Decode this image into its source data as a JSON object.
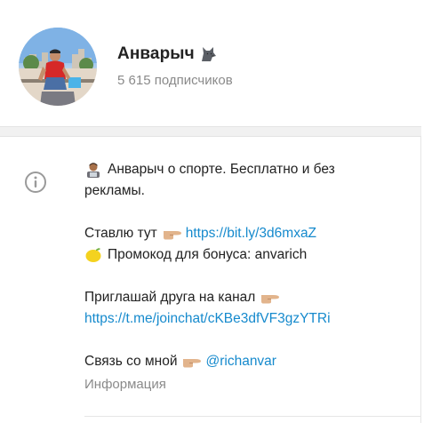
{
  "channel": {
    "name": "Анварыч",
    "name_emoji": "wolf-emoji",
    "subscribers": "5 615 подписчиков",
    "avatar": "channel-avatar-photo"
  },
  "info": {
    "icon": "info-icon",
    "caption": "Информация",
    "description": {
      "line1_emoji": "man-technologist-emoji",
      "line1": "Анварыч о спорте. Бесплатно и без",
      "line2": "рекламы.",
      "bet_text": "Ставлю тут",
      "bet_emoji": "pointing-right-emoji",
      "bet_link": "https://bit.ly/3d6mxaZ",
      "promo_emoji": "lemon-emoji",
      "promo_text": "Промокод для бонуса: anvarich",
      "invite_text": "Приглашай друга на канал",
      "invite_emoji": "pointing-right-emoji",
      "invite_link": "https://t.me/joinchat/cKBe3dfVF3gzYTRi",
      "contact_text": "Связь со мной",
      "contact_emoji": "pointing-right-emoji",
      "contact_link": "@richanvar"
    }
  },
  "colors": {
    "link": "#168acd",
    "secondary_text": "#8a8a8a",
    "separator": "#f1f1f1"
  }
}
